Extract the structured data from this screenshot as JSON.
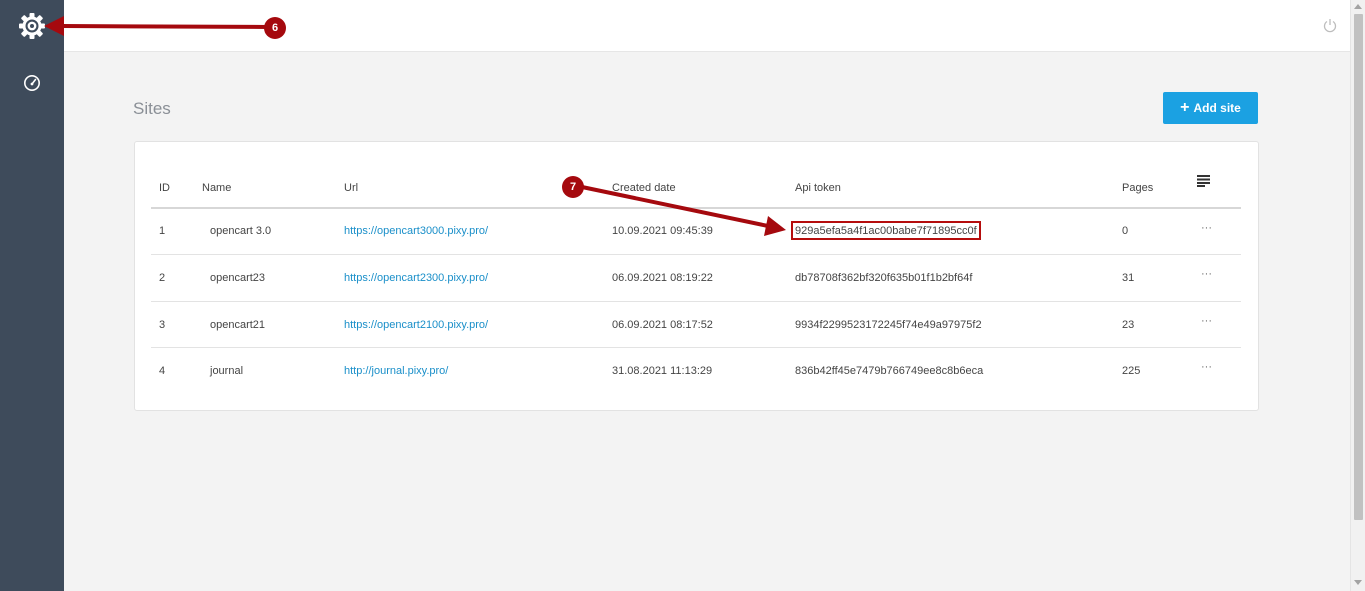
{
  "sidebar": {
    "items": [
      {
        "icon": "gear-icon"
      },
      {
        "icon": "dashboard-gauge-icon"
      }
    ]
  },
  "topbar": {
    "power_icon": "power-icon"
  },
  "page": {
    "title": "Sites"
  },
  "toolbar": {
    "add_site_label": "Add site"
  },
  "table": {
    "headers": {
      "id": "ID",
      "name": "Name",
      "url": "Url",
      "created": "Created date",
      "token": "Api token",
      "pages": "Pages"
    },
    "columns_icon": "columns-menu-icon",
    "rows": [
      {
        "id": "1",
        "name": "opencart 3.0",
        "url": "https://opencart3000.pixy.pro/",
        "created": "10.09.2021 09:45:39",
        "token": "929a5efa5a4f1ac00babe7f71895cc0f",
        "pages": "0",
        "actions": "···"
      },
      {
        "id": "2",
        "name": "opencart23",
        "url": "https://opencart2300.pixy.pro/",
        "created": "06.09.2021 08:19:22",
        "token": "db78708f362bf320f635b01f1b2bf64f",
        "pages": "31",
        "actions": "···"
      },
      {
        "id": "3",
        "name": "opencart21",
        "url": "https://opencart2100.pixy.pro/",
        "created": "06.09.2021 08:17:52",
        "token": "9934f2299523172245f74e49a97975f2",
        "pages": "23",
        "actions": "···"
      },
      {
        "id": "4",
        "name": "journal",
        "url": "http://journal.pixy.pro/",
        "created": "31.08.2021 11:13:29",
        "token": "836b42ff45e7479b766749ee8c8b6eca",
        "pages": "225",
        "actions": "···"
      }
    ]
  },
  "annotations": {
    "badge_6": "6",
    "badge_7": "7",
    "color": "#a5090e"
  },
  "colors": {
    "sidebar": "#3e4b5b",
    "accent": "#1ba1e2",
    "link": "#1a8fc9"
  }
}
